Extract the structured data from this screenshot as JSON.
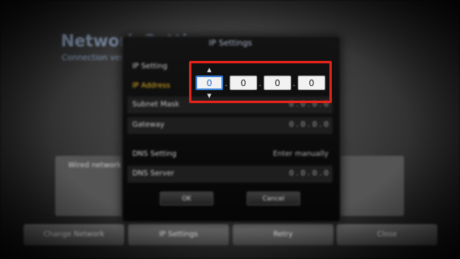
{
  "background": {
    "title": "Network Settings",
    "subtitle": "Connection verif",
    "panel_text": "Wired network c",
    "buttons": [
      "Change Network",
      "IP Settings",
      "Retry",
      "Close"
    ]
  },
  "dialog": {
    "title": "IP Settings",
    "rows": {
      "ip_setting": {
        "label": "IP Setting",
        "value": ""
      },
      "ip_address": {
        "label": "IP Address"
      },
      "subnet_mask": {
        "label": "Subnet Mask",
        "value": "0 . 0 . 0 . 0"
      },
      "gateway": {
        "label": "Gateway",
        "value": "0 . 0 . 0 . 0"
      },
      "dns_setting": {
        "label": "DNS Setting",
        "value": "Enter manually"
      },
      "dns_server": {
        "label": "DNS Server",
        "value": "0 . 0 . 0 . 0"
      }
    },
    "ip_fields": [
      "0",
      "0",
      "0",
      "0"
    ],
    "ip_separator": ".",
    "arrows": {
      "up": "▲",
      "down": "▼"
    },
    "ok_label": "OK",
    "cancel_label": "Cancel"
  },
  "colors": {
    "highlight": "#e2231a",
    "active_label": "#e0b020",
    "focus": "#3a7ed6"
  }
}
